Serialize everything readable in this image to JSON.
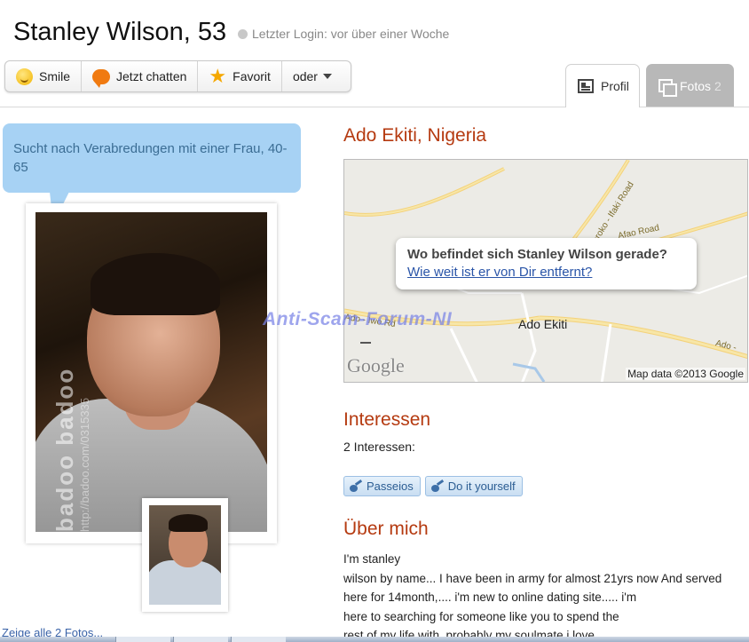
{
  "profile": {
    "name": "Stanley Wilson, 53",
    "last_login": "Letzter Login: vor über einer Woche"
  },
  "actions": {
    "smile": "Smile",
    "chat": "Jetzt chatten",
    "favorite": "Favorit",
    "more": "oder"
  },
  "tabs": {
    "profil": "Profil",
    "fotos": "Fotos",
    "fotos_count": "2"
  },
  "bubble": {
    "text": "Sucht nach Verabredungen mit einer Frau, 40-65"
  },
  "photo": {
    "watermark": "badoo badoo",
    "watermark_url": "http://badoo.com/0315335"
  },
  "photos_link": "Zeige alle 2 Fotos...",
  "location": {
    "title": "Ado Ekiti, Nigeria",
    "map_question": "Wo befindet sich Stanley Wilson gerade?",
    "map_link": "Wie weit ist er von Dir entfernt?",
    "map_city": "Ado Ekiti",
    "road_1": "Iworoko - Ifaki Road",
    "road_2": "Afao Road",
    "road_3": "Ado - Iwo Rd",
    "road_4": "Ado -",
    "google": "Google",
    "map_copyright": "Map data ©2013 Google"
  },
  "watermark": "Anti-Scam-Forum-NI",
  "interests": {
    "title": "Interessen",
    "count_label": "2 Interessen:",
    "items": [
      "Passeios",
      "Do it yourself"
    ]
  },
  "about": {
    "title": "Über mich",
    "lines": [
      "I'm stanley",
      "wilson by name... I have been in army for almost 21yrs now And served",
      "here for 14month,.... i'm new to online dating site..... i'm",
      "here to searching for someone like you to spend the",
      "rest of my life with. probably my soulmate i love"
    ]
  },
  "colors": {
    "accent": "#b53a10",
    "link": "#2a55a8",
    "bubble": "#a7d2f4",
    "tag": "#2d5e93"
  }
}
